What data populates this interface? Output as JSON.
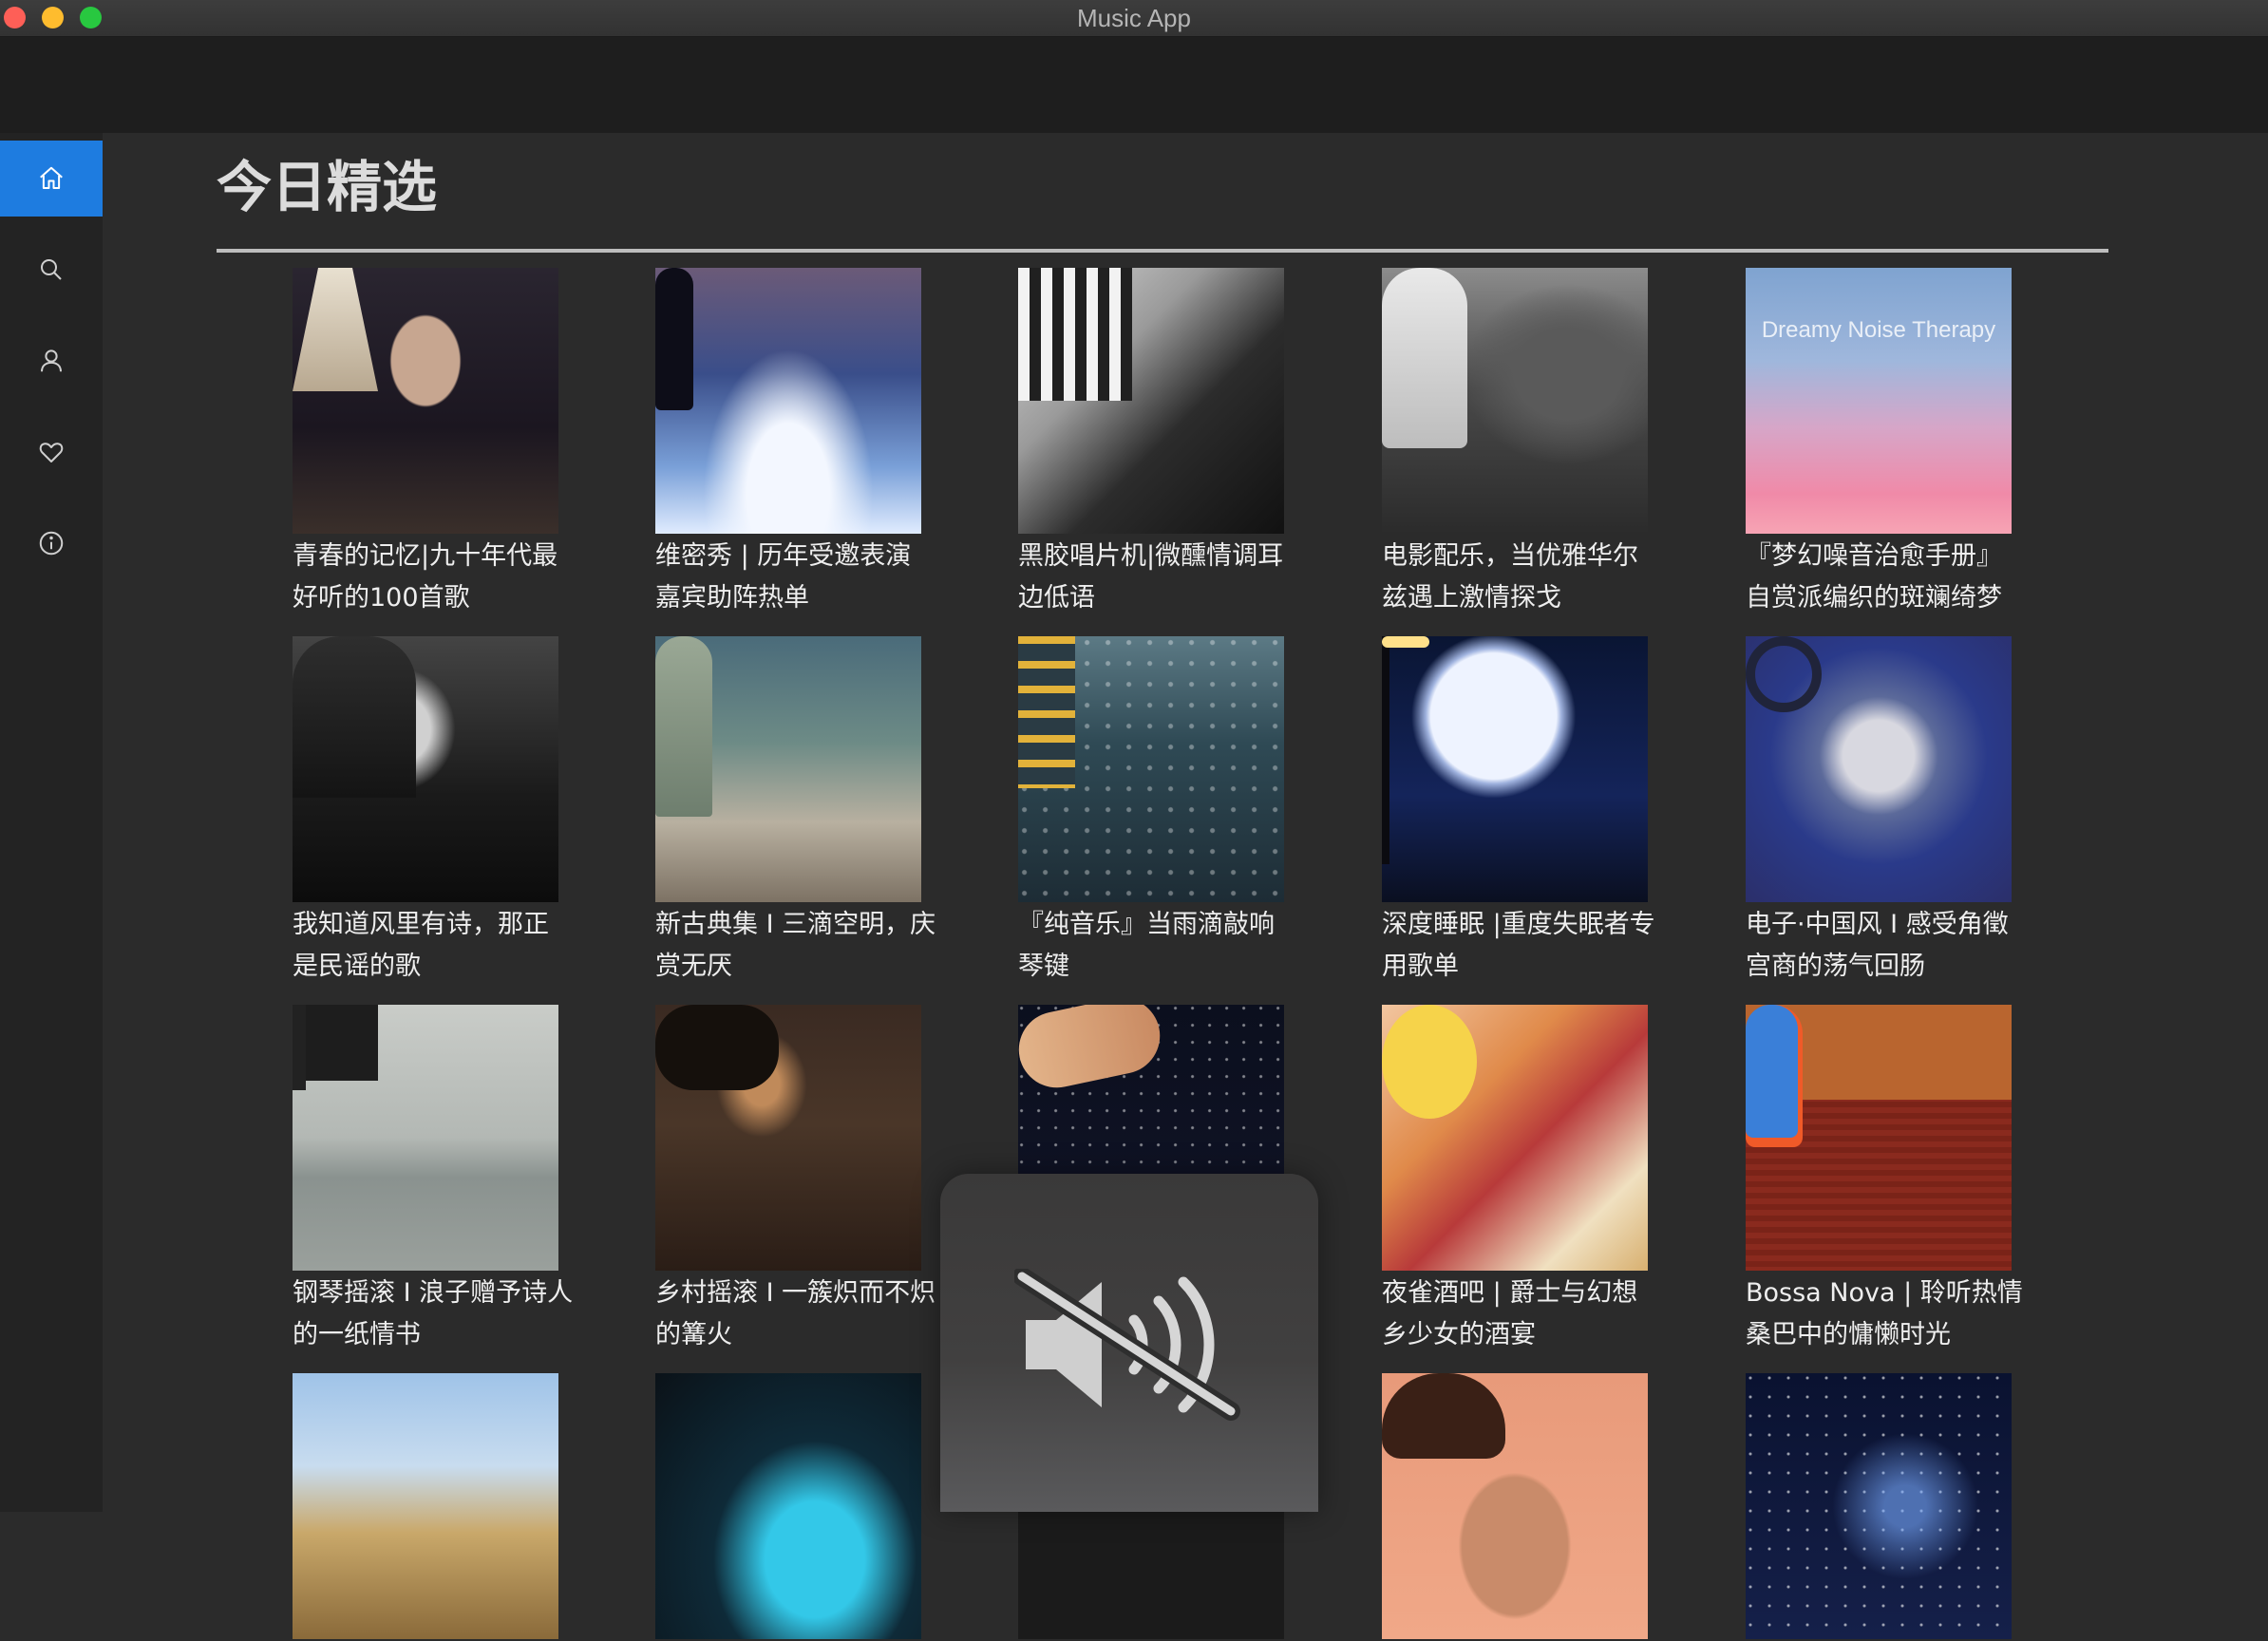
{
  "window": {
    "title": "Music App"
  },
  "sidebar": {
    "items": [
      {
        "id": "home",
        "icon": "home-icon",
        "active": true
      },
      {
        "id": "search",
        "icon": "search-icon",
        "active": false
      },
      {
        "id": "user",
        "icon": "user-icon",
        "active": false
      },
      {
        "id": "favorites",
        "icon": "heart-icon",
        "active": false
      },
      {
        "id": "about",
        "icon": "info-icon",
        "active": false
      }
    ]
  },
  "main": {
    "title": "今日精选",
    "playlists": [
      {
        "line1": "青春的记忆|九十年代最",
        "line2": "好听的100首歌"
      },
      {
        "line1": "维密秀 | 历年受邀表演",
        "line2": "嘉宾助阵热单"
      },
      {
        "line1": "黑胶唱片机|微醺情调耳",
        "line2": "边低语"
      },
      {
        "line1": "电影配乐，当优雅华尔",
        "line2": "兹遇上激情探戈"
      },
      {
        "line1": "『梦幻噪音治愈手册』",
        "line2": "自赏派编织的斑斓绮梦",
        "cover_text": "Dreamy Noise Therapy"
      },
      {
        "line1": "我知道风里有诗，那正",
        "line2": "是民谣的歌"
      },
      {
        "line1": "新古典集 I 三滴空明，庆",
        "line2": "赏无厌"
      },
      {
        "line1": "『纯音乐』当雨滴敲响",
        "line2": "琴键"
      },
      {
        "line1": "深度睡眠 |重度失眠者专",
        "line2": "用歌单"
      },
      {
        "line1": "电子·中国风 I 感受角徵",
        "line2": "宫商的荡气回肠"
      },
      {
        "line1": "钢琴摇滚 I 浪子赠予诗人",
        "line2": "的一纸情书"
      },
      {
        "line1": "乡村摇滚 I 一簇炽而不炽",
        "line2": "的篝火"
      },
      {
        "line1": "",
        "line2": ""
      },
      {
        "line1": "夜雀酒吧 | 爵士与幻想",
        "line2": "乡少女的酒宴"
      },
      {
        "line1": "Bossa Nova | 聆听热情",
        "line2": "桑巴中的慵懒时光"
      },
      {
        "line1": "",
        "line2": ""
      },
      {
        "line1": "",
        "line2": ""
      },
      {
        "line1": "",
        "line2": ""
      },
      {
        "line1": "",
        "line2": ""
      },
      {
        "line1": "",
        "line2": ""
      }
    ]
  },
  "overlay": {
    "icon": "volume-muted-icon",
    "muted": true
  },
  "colors": {
    "accent": "#1e7ce0",
    "background": "#2b2b2b",
    "sidebar": "#232323"
  }
}
